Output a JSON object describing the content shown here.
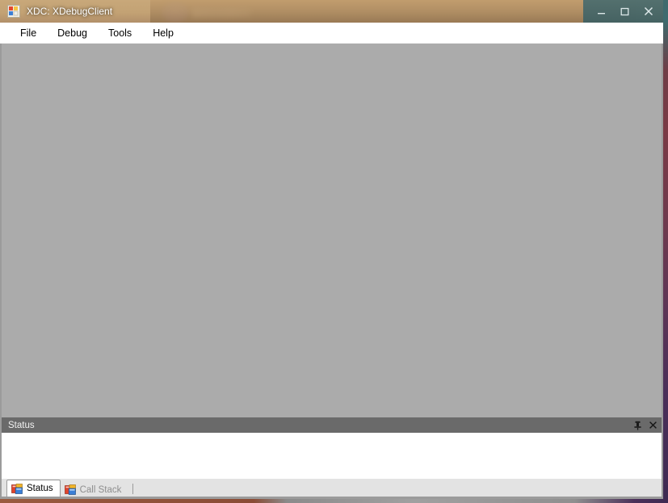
{
  "window": {
    "title": "XDC: XDebugClient",
    "app_icon": "windows-forms-app-icon",
    "controls": {
      "minimize_label": "Minimize",
      "maximize_label": "Maximize",
      "close_label": "Close"
    }
  },
  "menu": {
    "items": [
      {
        "label": "File",
        "name": "menu-item-file"
      },
      {
        "label": "Debug",
        "name": "menu-item-debug"
      },
      {
        "label": "Tools",
        "name": "menu-item-tools"
      },
      {
        "label": "Help",
        "name": "menu-item-help"
      }
    ]
  },
  "client": {
    "content": "",
    "background_color": "#ababab"
  },
  "status_dock": {
    "caption": "Status",
    "auto_hide_label": "Auto Hide",
    "close_label": "Close",
    "body_text": ""
  },
  "tabs": [
    {
      "label": "Status",
      "active": true,
      "icon": "document-window-icon"
    },
    {
      "label": "Call Stack",
      "active": false,
      "icon": "document-window-icon"
    }
  ],
  "colors": {
    "title_bar": "#c3a274",
    "window_controls_bar": "#4a6c6e",
    "menu_bar": "#ffffff",
    "client_area": "#ababab",
    "dock_caption": "#6a6a6a",
    "dock_body": "#ffffff",
    "tab_strip": "#e3e3e3",
    "tab_active": "#ffffff",
    "tab_inactive_text": "#8e8e8e",
    "window_border": "#9b9b9b",
    "desktop_left": "#c8a878",
    "desktop_right": "#4a2f59"
  }
}
